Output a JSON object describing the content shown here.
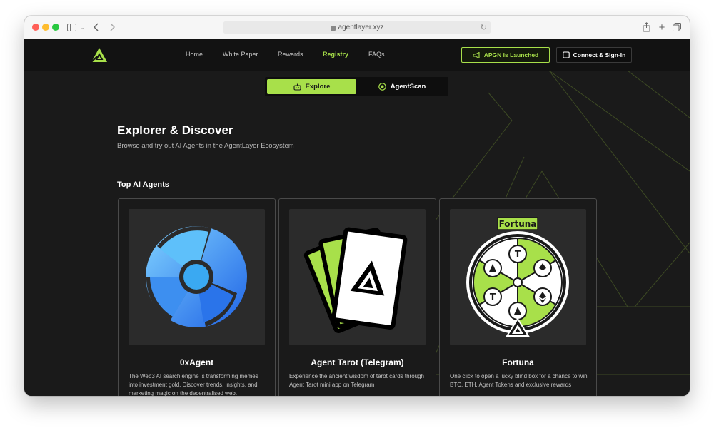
{
  "browser": {
    "url": "agentlayer.xyz"
  },
  "nav": {
    "links": [
      "Home",
      "White Paper",
      "Rewards",
      "Registry",
      "FAQs"
    ],
    "active": "Registry",
    "launch_button": "APGN is Launched",
    "connect_button": "Connect & Sign-In"
  },
  "toggle": {
    "explore": "Explore",
    "agentscan": "AgentScan"
  },
  "page": {
    "title": "Explorer & Discover",
    "subtitle": "Browse and try out AI Agents in the AgentLayer Ecosystem",
    "section_title": "Top AI Agents"
  },
  "cards": [
    {
      "name": "0xAgent",
      "description": "The Web3 AI search engine is transforming memes into investment gold. Discover trends, insights, and marketing magic on the decentralised web."
    },
    {
      "name": "Agent Tarot (Telegram)",
      "description": "Experience the ancient wisdom of tarot cards through Agent Tarot mini app on Telegram"
    },
    {
      "name": "Fortuna",
      "description": "One click to open a lucky blind box for a chance to win BTC, ETH, Agent Tokens and exclusive rewards",
      "image_label": "Fortuna"
    }
  ],
  "colors": {
    "accent": "#a8e04a",
    "background": "#1a1a1a",
    "navbar": "#121212"
  }
}
